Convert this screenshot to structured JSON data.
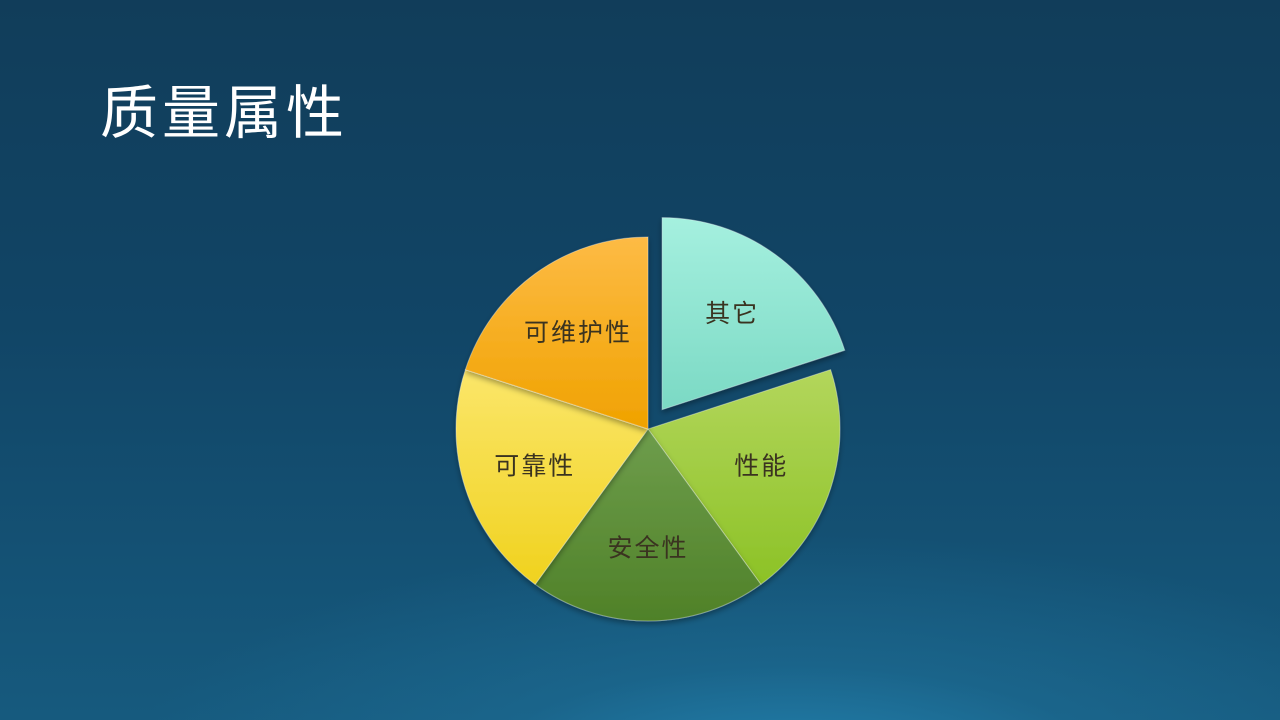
{
  "title": "质量属性",
  "chart_data": {
    "type": "pie",
    "title": "",
    "slices": [
      {
        "label": "其它",
        "value": 20,
        "color_light": "#a5f0df",
        "color_dark": "#7bd9c4",
        "text_color": "#2c3a33",
        "exploded": true
      },
      {
        "label": "性能",
        "value": 20,
        "color_light": "#b3d65c",
        "color_dark": "#8cc226",
        "text_color": "#33401e",
        "exploded": false
      },
      {
        "label": "安全性",
        "value": 20,
        "color_light": "#6e9d4c",
        "color_dark": "#4f8128",
        "text_color": "#3b5a2a",
        "exploded": false
      },
      {
        "label": "可靠性",
        "value": 20,
        "color_light": "#fbe66a",
        "color_dark": "#f0d21e",
        "text_color": "#3a3320",
        "exploded": false
      },
      {
        "label": "可维护性",
        "value": 20,
        "color_light": "#fdbb45",
        "color_dark": "#f0a200",
        "text_color": "#3a3320",
        "exploded": false
      }
    ]
  }
}
